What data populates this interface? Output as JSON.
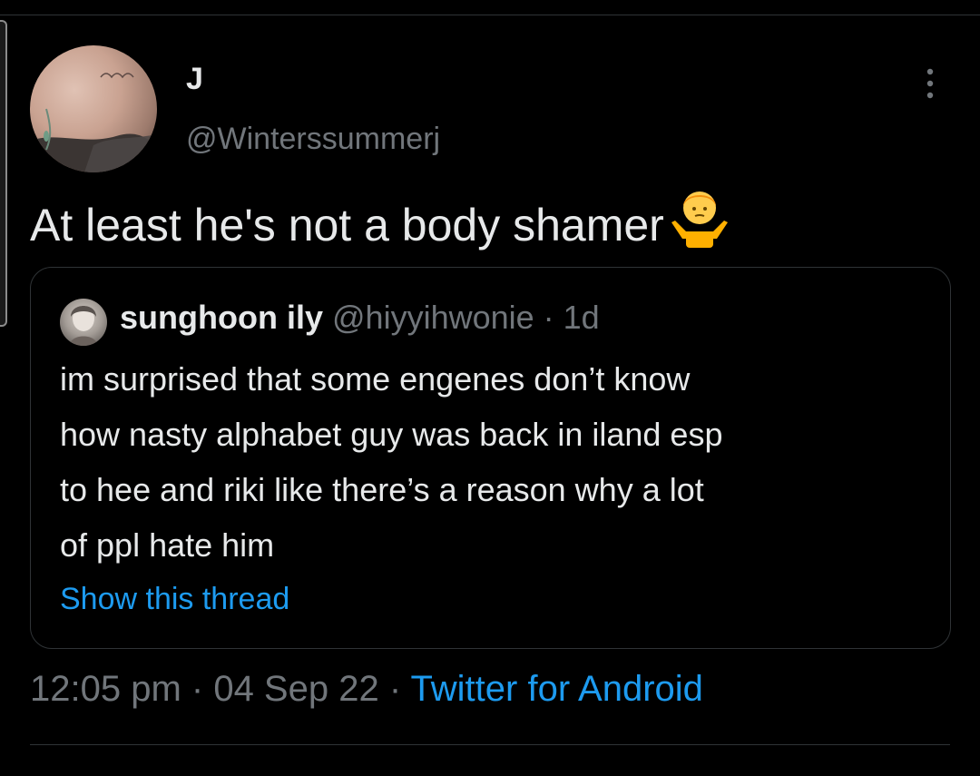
{
  "tweet": {
    "author": {
      "display_name": "J",
      "handle": "@Winterssummerj",
      "avatar_icon": "user-photo-avatar"
    },
    "text": "At least he's not a body shamer",
    "emoji": "person-shrugging-emoji",
    "more_icon": "vertical-ellipsis-icon",
    "timestamp": {
      "time": "12:05 pm",
      "separator": " · ",
      "date": "04 Sep 22",
      "source": "Twitter for Android"
    }
  },
  "quote": {
    "display_name": "sunghoon ily",
    "handle": "@hiyyihwonie",
    "separator": " · ",
    "age": "1d",
    "lines": [
      "im surprised that some engenes don’t know",
      "how nasty alphabet guy was back in iland esp",
      "to hee and riki like there’s a reason why a lot",
      "of ppl hate him"
    ],
    "show_thread": "Show this thread"
  },
  "colors": {
    "background": "#000000",
    "text_primary": "#e7e9ea",
    "text_secondary": "#71767b",
    "accent": "#1d9bf0",
    "border": "#2f3336"
  }
}
